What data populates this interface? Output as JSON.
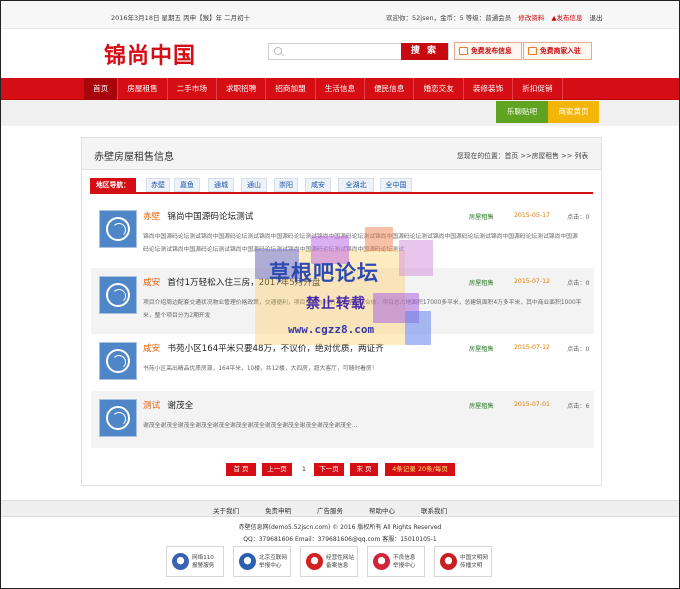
{
  "topbar": {
    "date": "2016年3月18日 星期五  丙申【猴】年 二月初十",
    "welcome": "欢迎你：52jsen，金币：5  等级：普通会员",
    "edit_profile": "修改资料",
    "post_info": "▲发布信息",
    "logout": "退出"
  },
  "header": {
    "logo": "锦尚中国",
    "search_placeholder": "",
    "search_button": "搜 索",
    "free_post": "免费发布信息",
    "free_shop": "免费商家入驻"
  },
  "nav": {
    "items": [
      "首页",
      "房屋租售",
      "二手市场",
      "求职招聘",
      "招商加盟",
      "生活信息",
      "便民信息",
      "婚恋交友",
      "装修装饰",
      "折扣促销"
    ],
    "tieba": "乐聊贴吧",
    "shop_page": "商家黄页"
  },
  "main": {
    "title": "赤壁房屋租售信息",
    "breadcrumb": "您现在的位置：首页 >>房屋租售 >> 列表",
    "region_label": "地区导航：",
    "regions": [
      "赤壁",
      "嘉鱼",
      "通城",
      "通山",
      "崇阳",
      "咸安",
      "全湖北",
      "全中国"
    ],
    "listings": [
      {
        "area": "赤壁",
        "title": "锦尚中国源码论坛测试",
        "category": "房屋租售",
        "date": "2015-05-17",
        "views": "点击：0",
        "desc": "锦尚中国源码论坛测试锦尚中国源码论坛测试锦尚中国源码论坛测试锦尚中国源码论坛测试锦尚中国源码论坛测试锦尚中国源码论坛测试锦尚中国源码论坛测试锦尚中国源码论坛测试锦尚中国源码论坛测试锦尚中国源码论坛测试锦尚中国源码论坛测试锦尚中国源码论坛测试"
      },
      {
        "area": "咸安",
        "title": "首付1万轻松入住三房，2017年5月开盘",
        "category": "房屋租售",
        "date": "2015-07-12",
        "views": "点击：0",
        "desc": "项目介绍周边配套交通状况物业管理价格政策，交通便利，项目主体为30万平米生态综合体，项目总占地面积17000多平米，总建筑面积4万多平米，其中商业面积1000平米，整个项目分为2期开发"
      },
      {
        "area": "咸安",
        "title": "书苑小区164平米只要48万，不议价，绝对优质，两证齐",
        "category": "房屋租售",
        "date": "2015-07-12",
        "views": "点击：0",
        "desc": "书苑小区高出精品优质房源，164平米，10楼，共12楼，大四房，超大客厅，可随时看房！"
      },
      {
        "area": "测试",
        "title": "谢茂全",
        "category": "房屋租售",
        "date": "2015-07-01",
        "views": "点击：6",
        "desc": "谢茂全谢茂全谢茂全谢茂全谢茂全谢茂全谢茂全谢茂全谢茂全谢茂全谢茂全谢茂全..."
      }
    ]
  },
  "pager": {
    "first": "首 页",
    "prev": "上一页",
    "page": "1",
    "next": "下一页",
    "last": "末 页",
    "total": "4条记录 20条/每页"
  },
  "footer": {
    "links": [
      "关于我们",
      "免责申明",
      "广告服务",
      "帮助中心",
      "联系我们"
    ],
    "copyright": "赤壁信息网(demo5.52jscn.com) © 2016 版权所有 All Rights Reserved",
    "contact": "QQ：379681606 Email：379681606@qq.com 客服：15010105-1",
    "badges": [
      {
        "line1": "网络110",
        "line2": "报警服务",
        "icon": "police-icon",
        "color": "#3a62b5"
      },
      {
        "line1": "北京互联网",
        "line2": "举报中心",
        "icon": "report-icon",
        "color": "#2d5fb0"
      },
      {
        "line1": "经营性网站",
        "line2": "备案信息",
        "icon": "record-icon",
        "color": "#d42020"
      },
      {
        "line1": "不良信息",
        "line2": "举报中心",
        "icon": "bad-info-icon",
        "color": "#d0263b"
      },
      {
        "line1": "中国文明网",
        "line2": "传播文明",
        "icon": "civilization-icon",
        "color": "#c81d23"
      }
    ]
  },
  "watermark": {
    "line1": "草根吧论坛",
    "line2": "禁止转载",
    "line3": "www.cgzz8.com"
  },
  "colors": {
    "brand_red": "#d40e14",
    "dark_red": "#a8060b",
    "green": "#5fa321",
    "yellow": "#f3b608",
    "link_blue": "#1a55a8"
  }
}
